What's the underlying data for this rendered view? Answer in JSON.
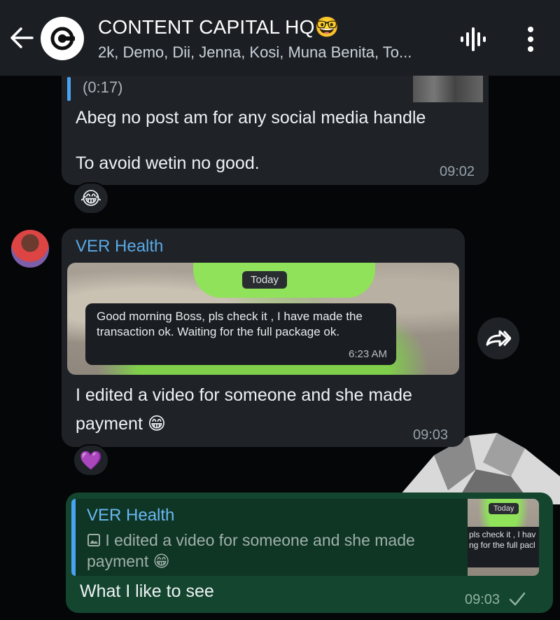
{
  "header": {
    "title": "CONTENT CAPITAL HQ🤓",
    "subtitle": "2k, Demo, Dii, Jenna, Kosi, Muna Benita, To..."
  },
  "messages": [
    {
      "quote_duration": "(0:17)",
      "line1": "Abeg no post am for any social media handle",
      "line2": "To avoid wetin no good.",
      "time": "09:02",
      "reaction": "😂"
    },
    {
      "sender": "VER Health",
      "media": {
        "date_pill": "Today",
        "text": "Good morning Boss, pls check it , I have made the transaction ok. Waiting for the full package ok.",
        "time": "6:23 AM"
      },
      "line1": "I edited a video for someone and she made",
      "line2": "payment 😁",
      "time": "09:03",
      "reaction": "💜"
    },
    {
      "reply": {
        "name": "VER Health",
        "text": "I edited a video for someone and she made payment 😁",
        "thumb_pill": "Today",
        "thumb_line1": "pls check it , I hav",
        "thumb_line2": "ng for the full pacl"
      },
      "text": "What I like to see",
      "time": "09:03"
    }
  ],
  "colors": {
    "header_bg": "#1b1f24",
    "incoming_bubble": "#1f2328",
    "outgoing_bubble": "#14452f",
    "accent_blue": "#5aa9e6"
  },
  "icons": [
    "back-arrow-icon",
    "group-logo-icon",
    "voice-chat-icon",
    "more-vert-icon",
    "forward-icon",
    "image-icon",
    "read-tick-icon"
  ]
}
